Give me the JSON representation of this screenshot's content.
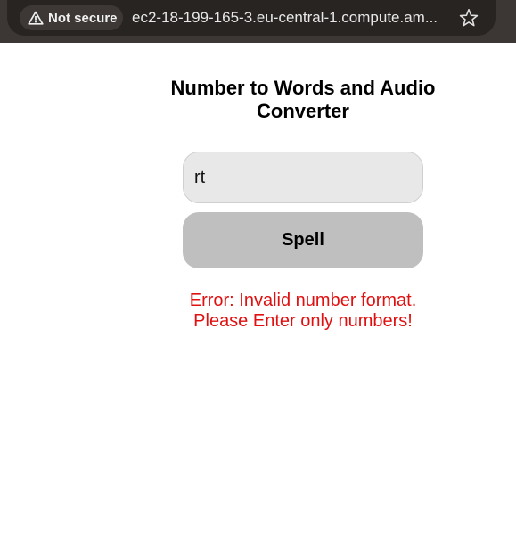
{
  "browser": {
    "security_label": "Not secure",
    "url": "ec2-18-199-165-3.eu-central-1.compute.am..."
  },
  "page": {
    "title": "Number to Words and Audio Converter",
    "input_value": "rt",
    "spell_label": "Spell",
    "error_line1": "Error: Invalid number format.",
    "error_line2": "Please Enter only numbers!"
  },
  "colors": {
    "error": "#e01010",
    "button_bg": "#bfbfbf",
    "input_bg": "#e8e8e8",
    "browser_bar": "#3c3634"
  },
  "icons": {
    "security": "warning-triangle-icon",
    "bookmark": "star-icon"
  }
}
